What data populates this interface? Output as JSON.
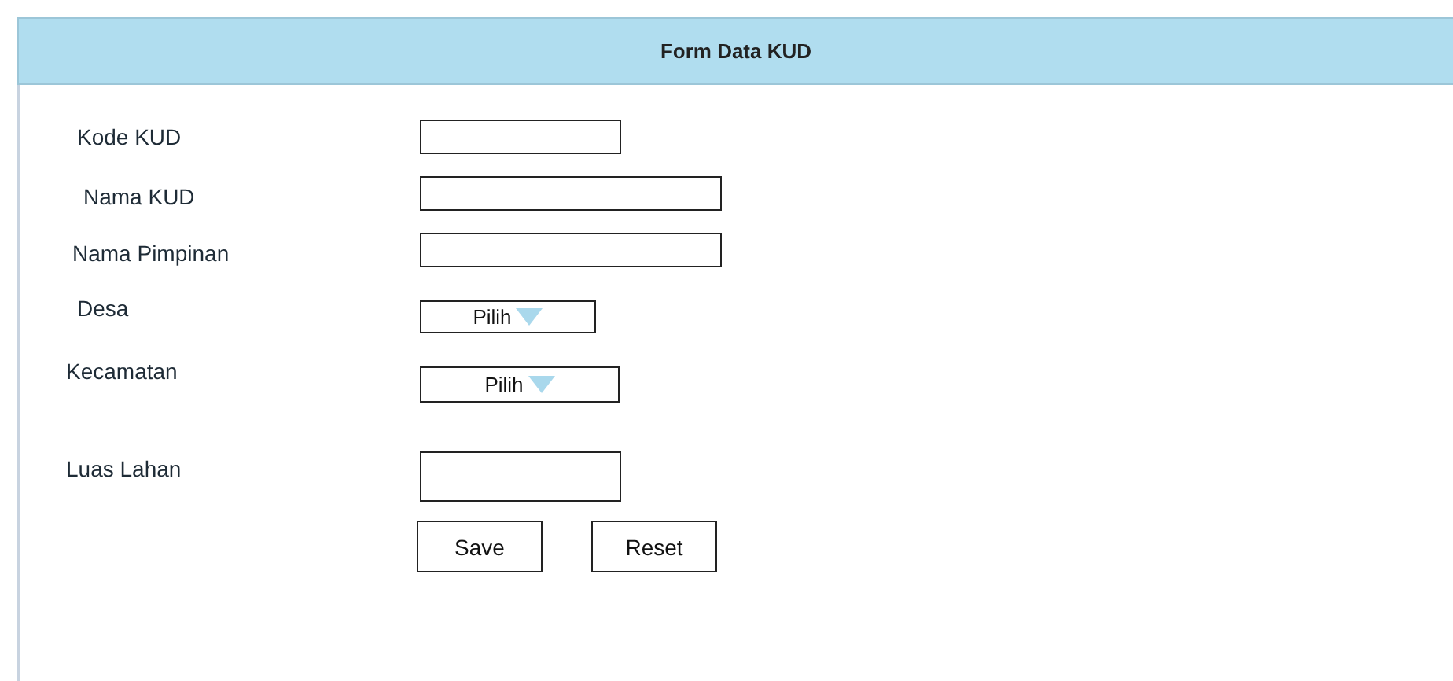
{
  "title": "Form Data KUD",
  "fields": [
    {
      "label": "Kode KUD",
      "kind": "text"
    },
    {
      "label": "Nama KUD",
      "kind": "text"
    },
    {
      "label": "Nama Pimpinan",
      "kind": "text"
    },
    {
      "label": "Desa",
      "kind": "select",
      "value": "Pilih"
    },
    {
      "label": "Kecamatan",
      "kind": "select",
      "value": "Pilih"
    },
    {
      "label": "Luas Lahan",
      "kind": "text"
    }
  ],
  "buttons": [
    "Save",
    "Reset"
  ]
}
